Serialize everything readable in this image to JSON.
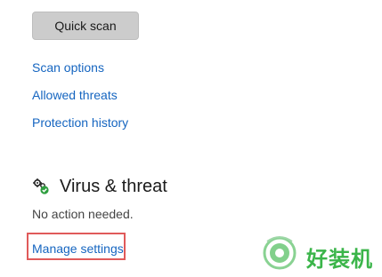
{
  "actions": {
    "quick_scan_label": "Quick scan"
  },
  "links": {
    "scan_options": "Scan options",
    "allowed_threats": "Allowed threats",
    "protection_history": "Protection history"
  },
  "settings_section": {
    "icon": "gear-shield-icon",
    "title": "Virus & threat",
    "status": "No action needed.",
    "manage_settings": "Manage settings"
  },
  "watermark": {
    "text": "好装机",
    "icon": "watermark-logo-icon"
  },
  "colors": {
    "link": "#1565c0",
    "button_bg": "#cccccc",
    "highlight": "#e05a5a",
    "watermark": "#3bb54a"
  }
}
